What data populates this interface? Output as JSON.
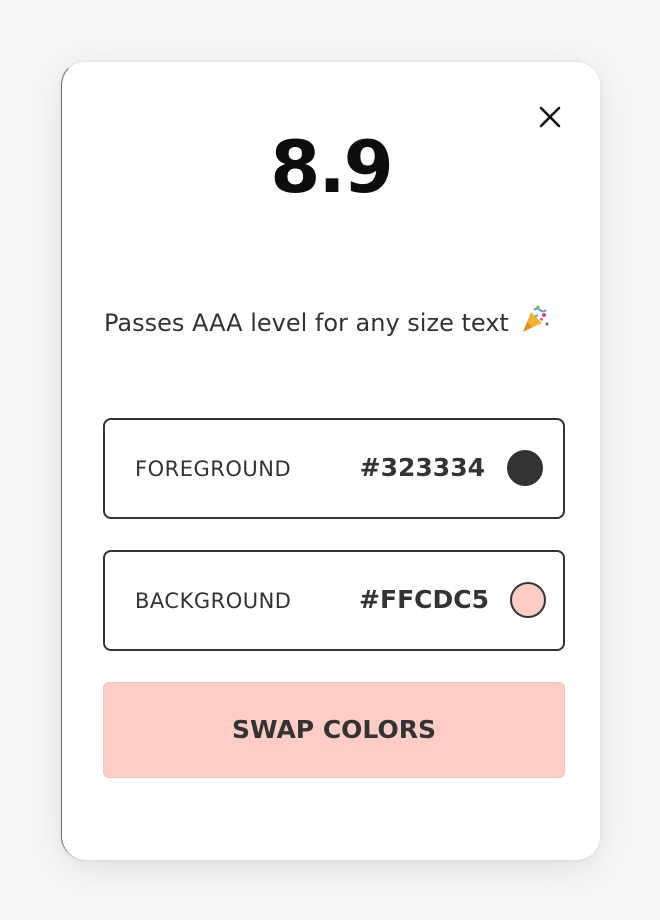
{
  "contrast": {
    "ratio": "8.9",
    "message": "Passes AAA level for any size text",
    "message_icon": "party-popper-icon"
  },
  "close": {
    "icon": "close-icon"
  },
  "foreground": {
    "label": "FOREGROUND",
    "hex": "#323334",
    "swatch_color": "#323334"
  },
  "background": {
    "label": "BACKGROUND",
    "hex": "#FFCDC5",
    "swatch_color": "#FFCDC5"
  },
  "actions": {
    "swap_label": "SWAP COLORS"
  },
  "theme": {
    "accent": "#FFCDC5",
    "text": "#333334"
  }
}
